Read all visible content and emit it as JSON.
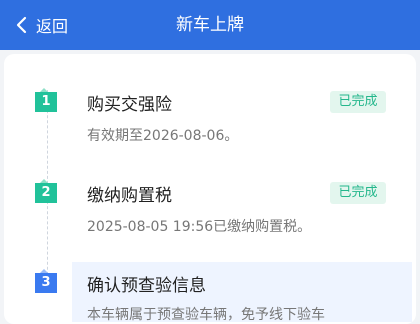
{
  "header": {
    "back_label": "返回",
    "title": "新车上牌"
  },
  "steps": [
    {
      "number": "1",
      "title": "购买交强险",
      "description": "有效期至2026-08-06。",
      "status": "已完成"
    },
    {
      "number": "2",
      "title": "缴纳购置税",
      "description": "2025-08-05 19:56已缴纳购置税。",
      "status": "已完成"
    },
    {
      "number": "3",
      "title": "确认预查验信息",
      "description": "本车辆属于预查验车辆，免予线下验车"
    }
  ],
  "colors": {
    "header": "#2f6fe0",
    "done": "#21c29a",
    "current": "#3a7af0"
  }
}
